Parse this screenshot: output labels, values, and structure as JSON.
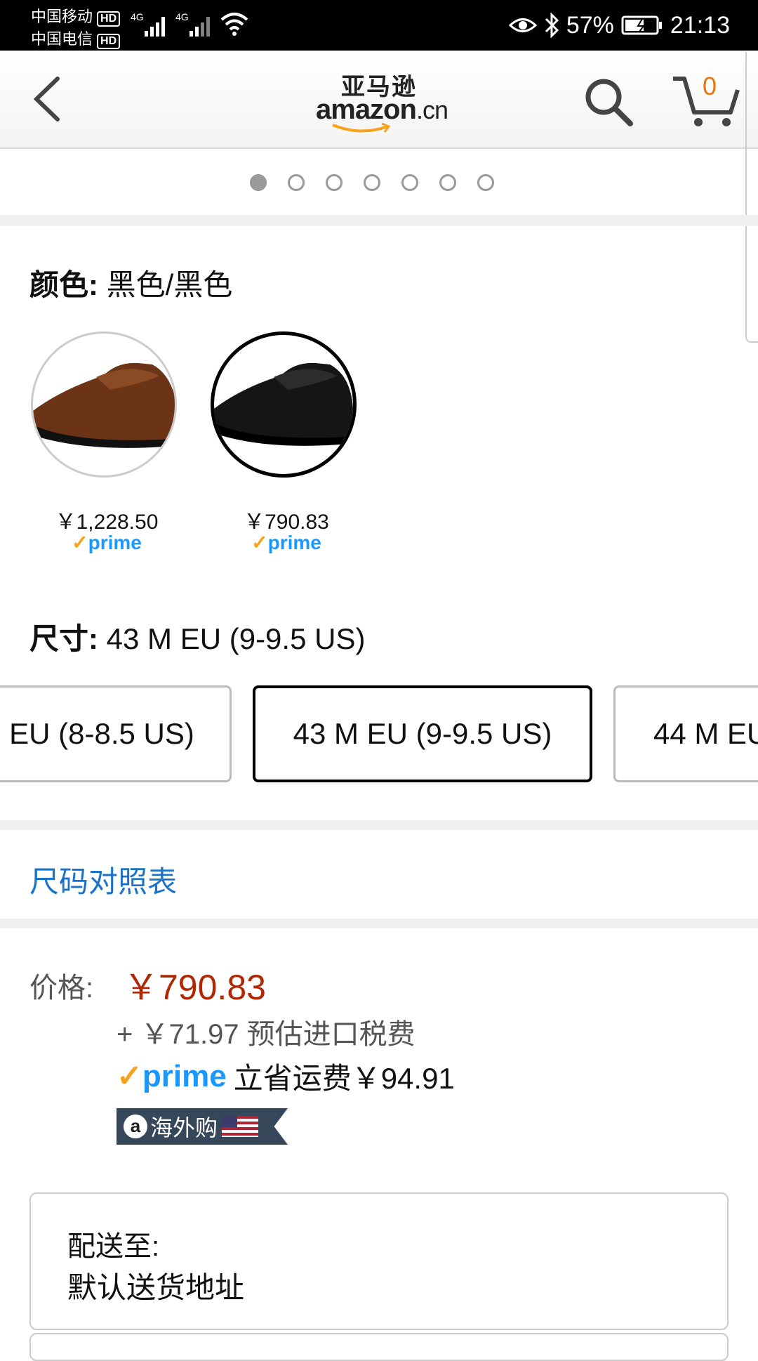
{
  "status_bar": {
    "carrier1": "中国移动",
    "carrier2": "中国电信",
    "hd": "HD",
    "net1": "4G",
    "net2": "4G",
    "battery": "57%",
    "time": "21:13"
  },
  "header": {
    "logo_zh": "亚马逊",
    "logo_en": "amazon",
    "logo_cn": ".cn",
    "cart_count": "0",
    "icons": [
      "back-icon",
      "search-icon",
      "cart-icon"
    ]
  },
  "gallery": {
    "total_dots": 7,
    "active_index": 0
  },
  "color": {
    "label": "颜色:",
    "value": "黑色/黑色",
    "options": [
      {
        "price": "￥1,228.50",
        "prime": "prime",
        "selected": false
      },
      {
        "price": "￥790.83",
        "prime": "prime",
        "selected": true
      }
    ]
  },
  "size": {
    "label": "尺寸:",
    "value": "43 M EU (9-9.5 US)",
    "options": [
      {
        "label": "EU (8-8.5 US)",
        "selected": false
      },
      {
        "label": "43 M EU (9-9.5 US)",
        "selected": true
      },
      {
        "label": "44 M EU",
        "selected": false
      }
    ]
  },
  "size_chart_link": "尺码对照表",
  "pricing": {
    "label": "价格:",
    "price": "￥790.83",
    "tax": "+ ￥71.97 预估进口税费",
    "prime": "prime",
    "shipping_save": "立省运费￥94.91",
    "badge": "海外购"
  },
  "shipping": {
    "label": "配送至:",
    "address": "默认送货地址"
  },
  "colors": {
    "price_red": "#b12704",
    "link_blue": "#1a73c9",
    "prime_blue": "#1a98ff",
    "prime_orange": "#f7a21b",
    "cart_orange": "#e47911"
  }
}
